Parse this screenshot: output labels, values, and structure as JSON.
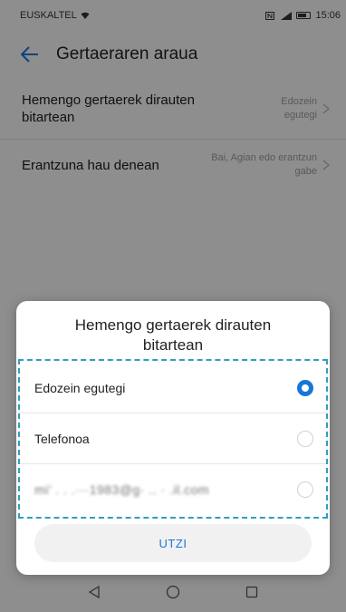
{
  "status_bar": {
    "carrier": "EUSKALTEL",
    "time": "15:06"
  },
  "app_bar": {
    "title": "Gertaeraren araua",
    "back_icon": "arrow-left-icon"
  },
  "settings": [
    {
      "label": "Hemengo gertaerek dirauten bitartean",
      "value": "Edozein egutegi"
    },
    {
      "label": "Erantzuna hau denean",
      "value": "Bai, Agian edo erantzun gabe"
    }
  ],
  "dialog": {
    "title": "Hemengo gertaerek dirauten bitartean",
    "options": [
      {
        "label": "Edozein egutegi",
        "selected": true
      },
      {
        "label": "Telefonoa",
        "selected": false
      },
      {
        "label": "mi’ . .   .···1983@g· .. · .il.com",
        "selected": false
      }
    ],
    "cancel_label": "UTZI"
  },
  "colors": {
    "accent": "#1875d9",
    "highlight_border": "#2f9fbd"
  }
}
